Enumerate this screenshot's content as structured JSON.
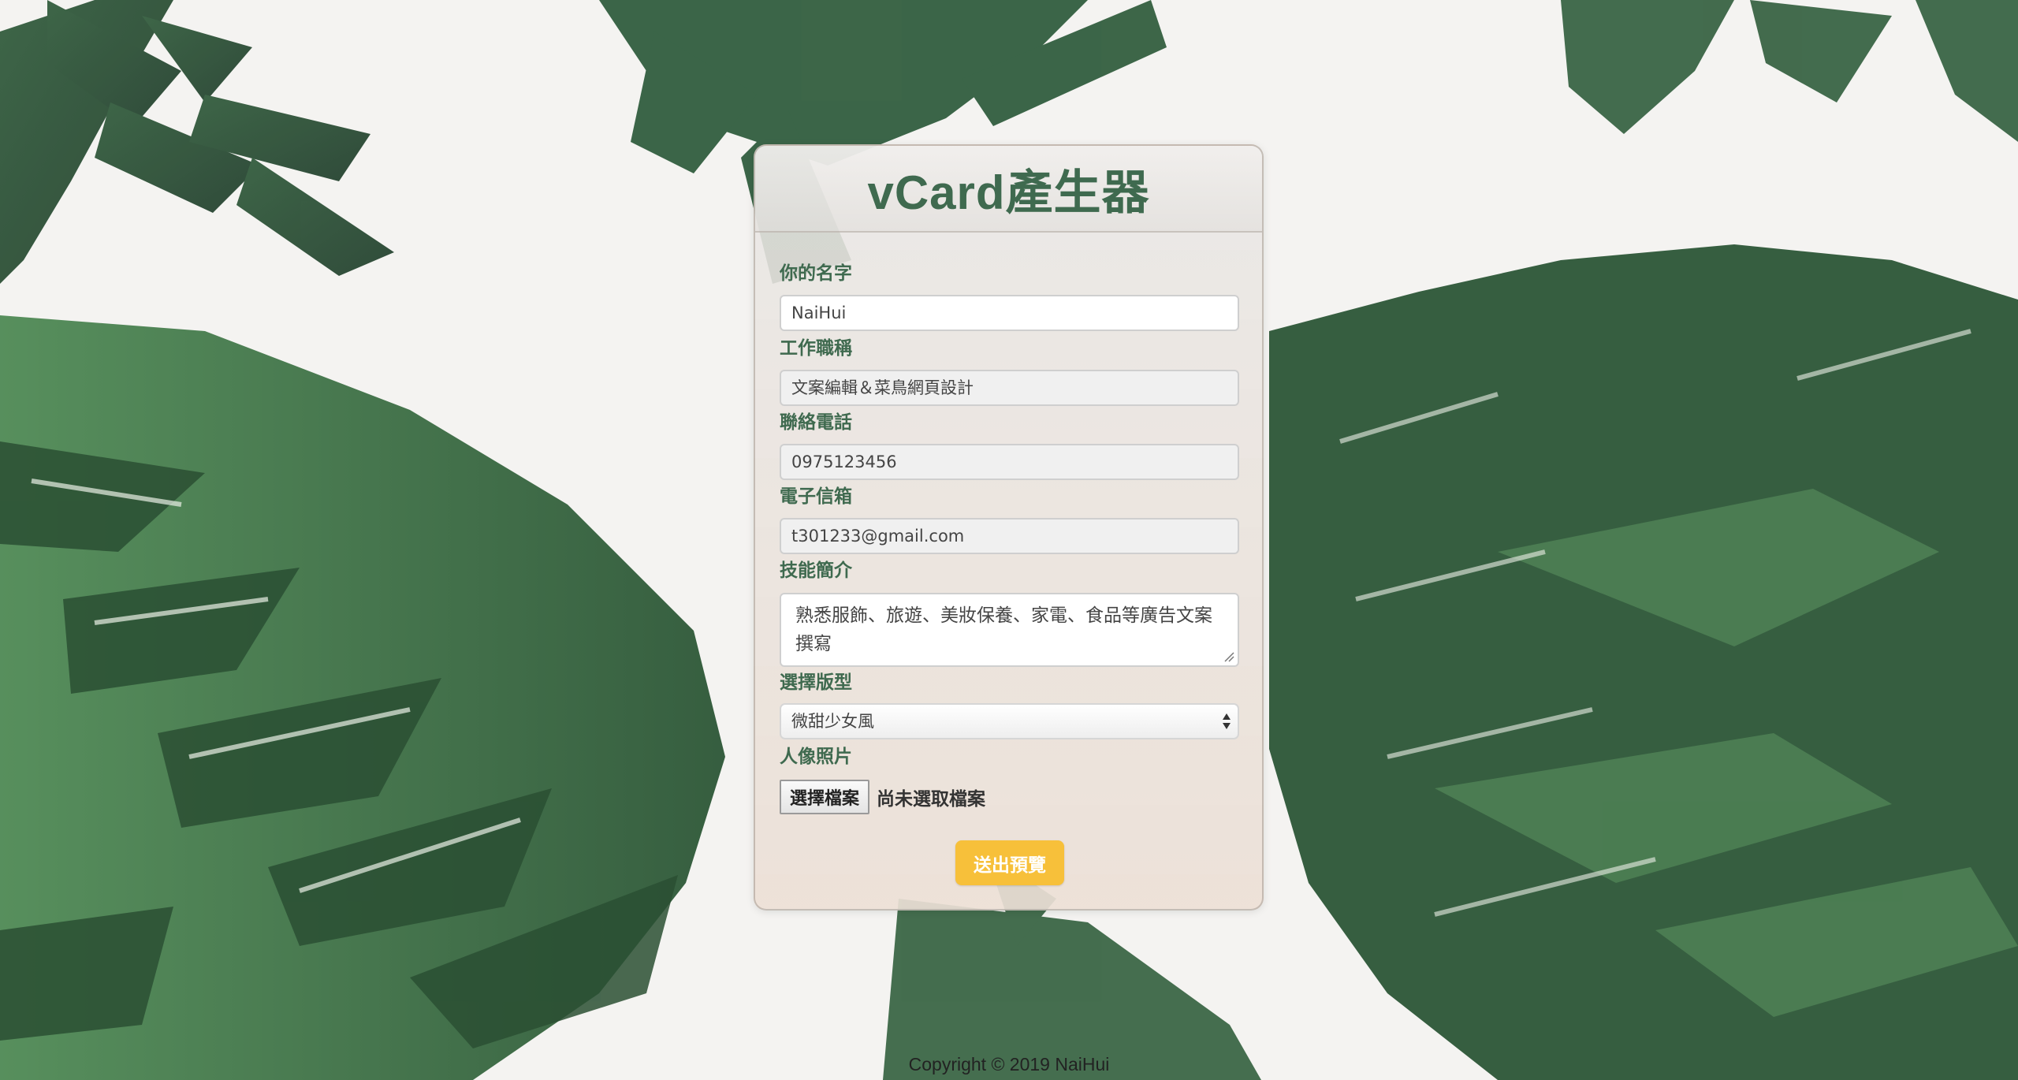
{
  "form": {
    "title": "vCard產生器",
    "fields": {
      "name": {
        "label": "你的名字",
        "value": "NaiHui"
      },
      "job_title": {
        "label": "工作職稱",
        "value": "文案編輯＆菜鳥網頁設計"
      },
      "phone": {
        "label": "聯絡電話",
        "value": "0975123456"
      },
      "email": {
        "label": "電子信箱",
        "value": "t301233@gmail.com"
      },
      "skills": {
        "label": "技能簡介",
        "value": "熟悉服飾、旅遊、美妝保養、家電、食品等廣告文案撰寫"
      },
      "template": {
        "label": "選擇版型",
        "selected": "微甜少女風"
      },
      "photo": {
        "label": "人像照片",
        "button_label": "選擇檔案",
        "status": "尚未選取檔案"
      }
    },
    "submit_label": "送出預覽"
  },
  "footer": {
    "text": "Copyright © 2019 NaiHui"
  },
  "colors": {
    "accent": "#3f6a4f",
    "button": "#f7c03a",
    "leaf_dark": "#24452f",
    "leaf_mid": "#3b6b45",
    "leaf_light": "#5c9560"
  },
  "background": {
    "motif": "watercolor-banana-leaves"
  }
}
